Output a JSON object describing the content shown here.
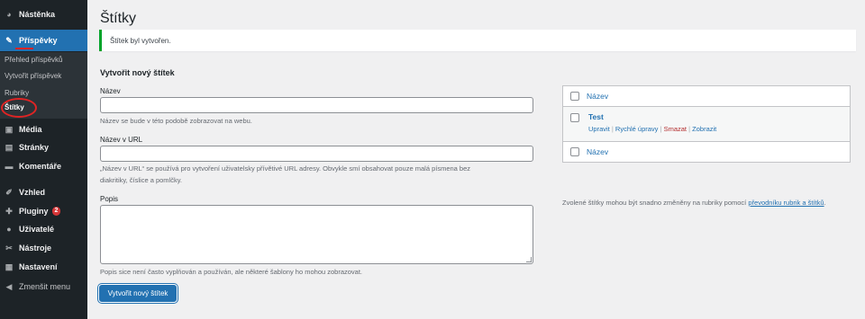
{
  "sidebar": {
    "items": [
      {
        "id": "dashboard",
        "label": "Nástěnka",
        "icon": "dashboard-icon",
        "glyph": "◕"
      },
      {
        "id": "posts",
        "label": "Příspěvky",
        "icon": "pushpin-icon",
        "glyph": "✎",
        "active": true
      },
      {
        "id": "media",
        "label": "Média",
        "icon": "media-icon",
        "glyph": "▣"
      },
      {
        "id": "pages",
        "label": "Stránky",
        "icon": "pages-icon",
        "glyph": "▤"
      },
      {
        "id": "comments",
        "label": "Komentáře",
        "icon": "comment-icon",
        "glyph": "▬"
      },
      {
        "id": "appearance",
        "label": "Vzhled",
        "icon": "brush-icon",
        "glyph": "✐"
      },
      {
        "id": "plugins",
        "label": "Pluginy",
        "icon": "plugin-icon",
        "glyph": "✚",
        "badge": "2"
      },
      {
        "id": "users",
        "label": "Uživatelé",
        "icon": "users-icon",
        "glyph": "●"
      },
      {
        "id": "tools",
        "label": "Nástroje",
        "icon": "wrench-icon",
        "glyph": "✂"
      },
      {
        "id": "settings",
        "label": "Nastavení",
        "icon": "settings-icon",
        "glyph": "▦"
      },
      {
        "id": "collapse",
        "label": "Zmenšit menu",
        "icon": "collapse-icon",
        "glyph": "◀"
      }
    ],
    "submenu": [
      {
        "label": "Přehled příspěvků"
      },
      {
        "label": "Vytvořit příspěvek"
      },
      {
        "label": "Rubriky"
      },
      {
        "label": "Štítky",
        "current": true
      }
    ]
  },
  "main": {
    "title": "Štítky",
    "notice": "Štítek byl vytvořen.",
    "form": {
      "heading": "Vytvořit nový štítek",
      "name_label": "Název",
      "name_value": "",
      "name_help": "Název se bude v této podobě zobrazovat na webu.",
      "slug_label": "Název v URL",
      "slug_value": "",
      "slug_help_line1": "„Název v URL“ se používá pro vytvoření uživatelsky přívětivé URL adresy. Obvykle smí obsahovat pouze malá písmena bez",
      "slug_help_line2": "diakritiky, číslice a pomlčky.",
      "desc_label": "Popis",
      "desc_value": "",
      "desc_help": "Popis sice není často vyplňován a používán, ale některé šablony ho mohou zobrazovat.",
      "submit": "Vytvořit nový štítek"
    },
    "table": {
      "column": "Název",
      "rows": [
        {
          "name": "Test",
          "actions": [
            "Upravit",
            "Rychlé úpravy",
            "Smazat",
            "Zobrazit"
          ]
        }
      ]
    },
    "note_text": "Zvolené štítky mohou být snadno změněny na rubriky pomocí ",
    "note_link": "převodníku rubrik a štítků",
    "note_end": "."
  },
  "colors": {
    "accent": "#2271b1",
    "sidebar": "#1d2327",
    "success": "#00a32a",
    "danger": "#b32d2e"
  }
}
